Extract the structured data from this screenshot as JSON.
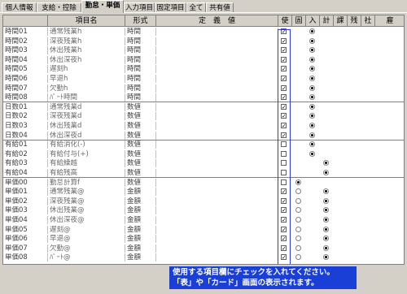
{
  "tabs": [
    {
      "label": "個人情報",
      "active": false
    },
    {
      "label": "支給・控除",
      "active": false
    },
    {
      "label": "勤怠・単価",
      "active": true
    },
    {
      "label": "入力項目",
      "active": false
    },
    {
      "label": "固定項目",
      "active": false
    },
    {
      "label": "全て",
      "active": false
    },
    {
      "label": "共有値",
      "active": false
    }
  ],
  "header": {
    "col_name": "",
    "col_item": "項目名",
    "col_format": "形式",
    "col_definition": "定　義　値",
    "flags": [
      "使",
      "固",
      "入",
      "計",
      "課",
      "残",
      "社",
      "雇"
    ]
  },
  "rows": [
    {
      "name": "時間01",
      "item": "通常残業h",
      "format": "時間",
      "use": true,
      "fix": false,
      "inp": true,
      "calc": false
    },
    {
      "name": "時間02",
      "item": "深夜残業h",
      "format": "時間",
      "use": true,
      "fix": false,
      "inp": true,
      "calc": false
    },
    {
      "name": "時間03",
      "item": "休出残業h",
      "format": "時間",
      "use": true,
      "fix": false,
      "inp": true,
      "calc": false
    },
    {
      "name": "時間04",
      "item": "休出深夜h",
      "format": "時間",
      "use": true,
      "fix": false,
      "inp": true,
      "calc": false
    },
    {
      "name": "時間05",
      "item": "遅刻h",
      "format": "時間",
      "use": true,
      "fix": false,
      "inp": true,
      "calc": false
    },
    {
      "name": "時間06",
      "item": "早退h",
      "format": "時間",
      "use": true,
      "fix": false,
      "inp": true,
      "calc": false
    },
    {
      "name": "時間07",
      "item": "欠勤h",
      "format": "時間",
      "use": true,
      "fix": false,
      "inp": true,
      "calc": false
    },
    {
      "name": "時間08",
      "item": "ﾊﾟｰﾄ時間",
      "format": "時間",
      "use": true,
      "fix": false,
      "inp": true,
      "calc": false,
      "groupend": true
    },
    {
      "name": "日数01",
      "item": "通常残業d",
      "format": "数値",
      "use": true,
      "fix": false,
      "inp": true,
      "calc": false
    },
    {
      "name": "日数02",
      "item": "深夜残業d",
      "format": "数値",
      "use": true,
      "fix": false,
      "inp": true,
      "calc": false
    },
    {
      "name": "日数03",
      "item": "休出残業d",
      "format": "数値",
      "use": true,
      "fix": false,
      "inp": true,
      "calc": false
    },
    {
      "name": "日数04",
      "item": "休出深夜d",
      "format": "数値",
      "use": true,
      "fix": false,
      "inp": true,
      "calc": false,
      "groupend": true
    },
    {
      "name": "有給01",
      "item": "有給消化(-)",
      "format": "数値",
      "use": false,
      "fix": false,
      "inp": true,
      "calc": false
    },
    {
      "name": "有給02",
      "item": "有給付与(+)",
      "format": "数値",
      "use": false,
      "fix": false,
      "inp": true,
      "calc": false
    },
    {
      "name": "有給03",
      "item": "有給繰越",
      "format": "数値",
      "use": false,
      "fix": false,
      "inp": false,
      "calc": true
    },
    {
      "name": "有給04",
      "item": "有給残高",
      "format": "数値",
      "use": false,
      "fix": false,
      "inp": false,
      "calc": true,
      "groupend": true
    },
    {
      "name": "単価00",
      "item": "勤怠計算f",
      "format": "数値",
      "use": false,
      "fix": true,
      "inp": false,
      "calc": false
    },
    {
      "name": "単価01",
      "item": "通常残業@",
      "format": "金額",
      "use": true,
      "fix": false,
      "inp": false,
      "calc": true
    },
    {
      "name": "単価02",
      "item": "深夜残業@",
      "format": "金額",
      "use": true,
      "fix": false,
      "inp": false,
      "calc": true
    },
    {
      "name": "単価03",
      "item": "休出残業@",
      "format": "金額",
      "use": true,
      "fix": false,
      "inp": false,
      "calc": true
    },
    {
      "name": "単価04",
      "item": "休出深夜@",
      "format": "金額",
      "use": true,
      "fix": false,
      "inp": false,
      "calc": true
    },
    {
      "name": "単価05",
      "item": "遅刻@",
      "format": "金額",
      "use": true,
      "fix": false,
      "inp": false,
      "calc": true
    },
    {
      "name": "単価06",
      "item": "早退@",
      "format": "金額",
      "use": true,
      "fix": false,
      "inp": false,
      "calc": true
    },
    {
      "name": "単価07",
      "item": "欠勤@",
      "format": "金額",
      "use": true,
      "fix": false,
      "inp": false,
      "calc": true
    },
    {
      "name": "単価08",
      "item": "ﾊﾟｰﾄ@",
      "format": "金額",
      "use": true,
      "fix": false,
      "inp": false,
      "calc": true
    }
  ],
  "note": {
    "line1": "使用する項目欄にチェックを入れてください。",
    "line2": "「表」や「カード」画面の表示されます。"
  },
  "colors": {
    "highlight": "#2a3fcf",
    "note_bg": "#1a3fd6"
  }
}
